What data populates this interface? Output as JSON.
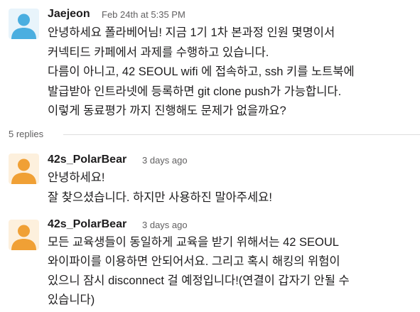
{
  "colors": {
    "avatar_blue": "#4aaee0",
    "avatar_orange": "#f0a035",
    "text": "#1d1c1d",
    "muted": "#616061"
  },
  "parent": {
    "author": "Jaejeon",
    "timestamp": "Feb 24th at 5:35 PM",
    "avatar_icon": "default-user-avatar-icon",
    "lines": [
      "안녕하세요 폴라베어님! 지금 1기 1차 본과정 인원 몇명이서",
      "커넥티드 카페에서 과제를 수행하고 있습니다.",
      "다름이 아니고, 42 SEOUL wifi 에 접속하고, ssh 키를 노트북에",
      "발급받아 인트라넷에 등록하면 git clone push가 가능합니다.",
      "이렇게 동료평가 까지 진행해도 문제가 없을까요?"
    ]
  },
  "replies_label": "5 replies",
  "replies": [
    {
      "author": "42s_PolarBear",
      "timestamp": "3 days ago",
      "avatar_icon": "default-user-avatar-icon",
      "lines": [
        "안녕하세요!",
        "잘 찾으셨습니다. 하지만 사용하진 말아주세요!"
      ]
    },
    {
      "author": "42s_PolarBear",
      "timestamp": "3 days ago",
      "avatar_icon": "default-user-avatar-icon",
      "lines": [
        "모든 교육생들이 동일하게 교육을 받기 위해서는 42 SEOUL",
        "와이파이를 이용하면 안되어서요. 그리고 혹시 해킹의 위험이",
        "있으니 잠시 disconnect 걸 예정입니다!(연결이 갑자기 안될 수",
        "있습니다)"
      ]
    }
  ]
}
